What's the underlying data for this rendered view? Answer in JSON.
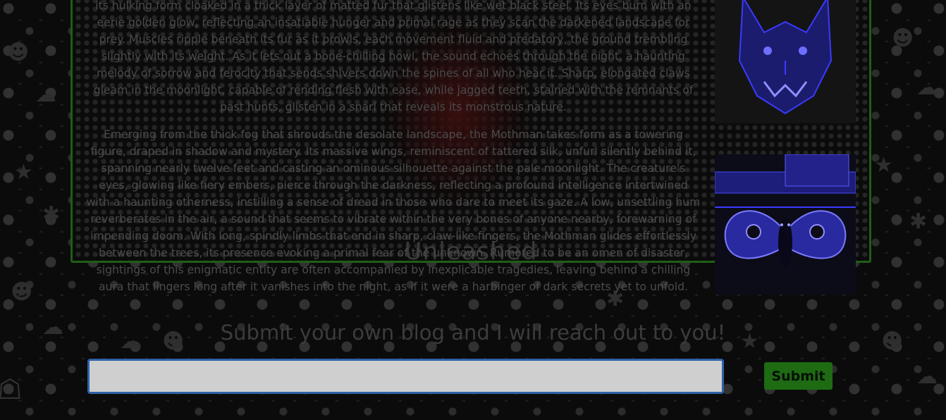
{
  "background": {
    "theme": "halloween-pattern",
    "icons": [
      "pumpkin-icon",
      "ghost-icon",
      "spider-icon",
      "star-icon"
    ]
  },
  "blog": {
    "frame_title": "Unleashed",
    "paragraphs": [
      "its hulking form cloaked in a thick layer of matted fur that glistens like wet black steel. Its eyes burn with an eerie golden glow, reflecting an insatiable hunger and primal rage as they scan the darkened landscape for prey. Muscles ripple beneath its fur as it prowls, each movement fluid and predatory, the ground trembling slightly with its weight. As it lets out a bone-chilling howl, the sound echoes through the night, a haunting melody of sorrow and ferocity that sends shivers down the spines of all who hear it. Sharp, elongated claws gleam in the moonlight, capable of rending flesh with ease, while jagged teeth, stained with the remnants of past hunts, glisten in a snarl that reveals its monstrous nature.",
      "Emerging from the thick fog that shrouds the desolate landscape, the Mothman takes form as a towering figure, draped in shadow and mystery. Its massive wings, reminiscent of tattered silk, unfurl silently behind it, spanning nearly twelve feet and casting an ominous silhouette against the pale moonlight. The creature's eyes, glowing like fiery embers, pierce through the darkness, reflecting a profound intelligence intertwined with a haunting otherness, instilling a sense of dread in those who dare to meet its gaze. A low, unsettling hum reverberates in the air, a sound that seems to vibrate within the very bones of anyone nearby, forewarning of impending doom. With long, spindly limbs that end in sharp, claw-like fingers, the Mothman glides effortlessly between the trees, its presence evoking a primal fear of the unknown. Rumored to be an omen of disaster, sightings of this enigmatic entity are often accompanied by inexplicable tragedies, leaving behind a chilling aura that lingers long after it vanishes into the night, as if it were a harbinger of dark secrets yet to unfold."
    ],
    "images": [
      "werewolf-illustration",
      "mothman-illustration"
    ]
  },
  "submission": {
    "heading": "Submit your own blog and I will reach out to you!",
    "input_value": "",
    "button_label": "Submit"
  },
  "colors": {
    "frame_border": "#1f5e16",
    "button_bg": "#1e6b14",
    "input_border": "#2f62a8",
    "art_blue": "#3a3aff"
  }
}
